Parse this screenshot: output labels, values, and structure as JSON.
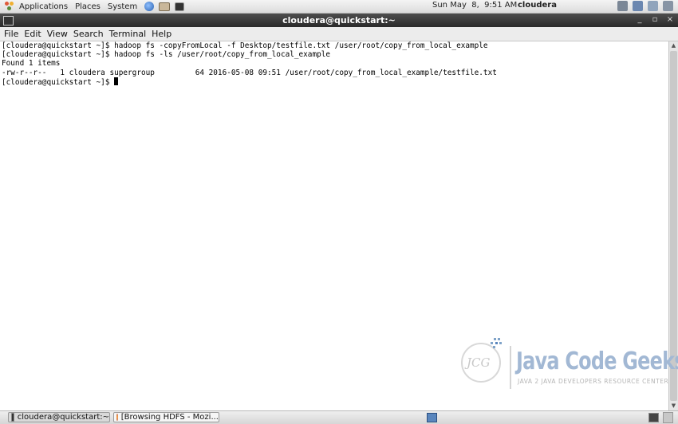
{
  "top_panel": {
    "menus": [
      "Applications",
      "Places",
      "System"
    ],
    "clock": "Sun May  8,  9:51 AM",
    "user": "cloudera",
    "launcher_icons": [
      "browser-icon",
      "mail-icon",
      "terminal-launcher-icon"
    ],
    "tray_icons": [
      "volume-icon",
      "network-icon",
      "sync-icon",
      "battery-icon"
    ]
  },
  "window": {
    "title": "cloudera@quickstart:~",
    "controls": [
      "_",
      "▫",
      "×"
    ]
  },
  "menubar": {
    "items": [
      "File",
      "Edit",
      "View",
      "Search",
      "Terminal",
      "Help"
    ]
  },
  "terminal": {
    "lines": [
      "[cloudera@quickstart ~]$ hadoop fs -copyFromLocal -f Desktop/testfile.txt /user/root/copy_from_local_example",
      "[cloudera@quickstart ~]$ hadoop fs -ls /user/root/copy_from_local_example",
      "Found 1 items",
      "-rw-r--r--   1 cloudera supergroup         64 2016-05-08 09:51 /user/root/copy_from_local_example/testfile.txt"
    ],
    "prompt": "[cloudera@quickstart ~]$ "
  },
  "watermark": {
    "logo_text": "JCG",
    "brand": "Java Code Geeks",
    "tagline": "JAVA 2 JAVA DEVELOPERS RESOURCE CENTER"
  },
  "taskbar": {
    "tasks": [
      {
        "label": "cloudera@quickstart:~",
        "icon": "terminal-icon"
      },
      {
        "label": "[Browsing HDFS - Mozi...",
        "icon": "firefox-icon"
      }
    ]
  },
  "colors": {
    "titlebar": "#3a3a3a",
    "watermark_blue": "#a2b8d4",
    "workspace": "#5a86bd"
  }
}
